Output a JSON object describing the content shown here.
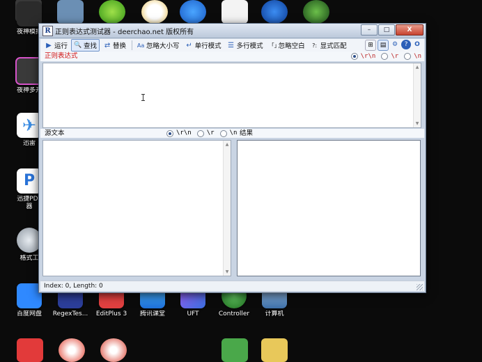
{
  "desktop": {
    "left_icons": [
      {
        "label": "夜神模拟",
        "icon": "nox-icon",
        "color": "#2b2b2b",
        "accent": "#66c23a"
      },
      {
        "label": "夜神多开",
        "icon": "nox-multi-icon",
        "color": "#3a3a3a",
        "accent": "#d653c9"
      },
      {
        "label": "迅雷",
        "icon": "xunlei-icon",
        "color": "#ffffff",
        "accent": "#3b8de4"
      },
      {
        "label": "迅捷PDF\n器",
        "icon": "pdf-icon",
        "color": "#ffffff",
        "accent": "#2a73d8"
      },
      {
        "label": "格式工",
        "icon": "format-tool-icon",
        "color": "#9aa3ad",
        "accent": "#d7dde4"
      }
    ],
    "bottom_icons": [
      {
        "label": "百度网盘",
        "icon": "baidu-netdisk-icon",
        "color": "#2f89ff"
      },
      {
        "label": "RegexTes...",
        "icon": "regextester-icon",
        "color": "#2c3e9a"
      },
      {
        "label": "EditPlus 3",
        "icon": "editplus-icon",
        "color": "#e04040"
      },
      {
        "label": "腾讯课堂",
        "icon": "tencent-classroom-icon",
        "color": "#3ba0ff"
      },
      {
        "label": "UFT",
        "icon": "uft-icon",
        "color": "#6b3fd4"
      },
      {
        "label": "Controller",
        "icon": "controller-icon",
        "color": "#3a9b3a"
      },
      {
        "label": "计算机",
        "icon": "computer-icon",
        "color": "#6fa8dc"
      }
    ]
  },
  "window": {
    "title": "正则表达式测试器 - deerchao.net 版权所有",
    "app_icon": "R",
    "buttons": {
      "minimize": "–",
      "maximize": "□",
      "close": "X"
    }
  },
  "toolbar": {
    "items": [
      {
        "label": "运行",
        "icon": "run-icon",
        "glyph": "▶"
      },
      {
        "label": "查找",
        "icon": "find-icon",
        "glyph": "🔍",
        "active": true
      },
      {
        "label": "替换",
        "icon": "replace-icon",
        "glyph": "⇄"
      },
      {
        "label": "忽略大小写",
        "icon": "ignore-case-icon",
        "glyph": "Aa"
      },
      {
        "label": "单行模式",
        "icon": "single-line-icon",
        "glyph": "↵"
      },
      {
        "label": "多行模式",
        "icon": "multi-line-icon",
        "glyph": "☰"
      },
      {
        "label": "忽略空白",
        "icon": "ignore-whitespace-icon",
        "glyph": "「」"
      },
      {
        "label": "显式匹配",
        "icon": "explicit-capture-icon",
        "glyph": "?:"
      }
    ]
  },
  "regex": {
    "label": "正则表达式",
    "newline_options": [
      "\\r\\n",
      "\\r",
      "\\n"
    ],
    "selected": 0,
    "value": ""
  },
  "source": {
    "label": "源文本",
    "newline_options": [
      "\\r\\n",
      "\\r",
      "\\n"
    ],
    "selected": 0,
    "value": ""
  },
  "result": {
    "label": "结果",
    "value": ""
  },
  "status": {
    "text": "Index: 0, Length: 0"
  }
}
